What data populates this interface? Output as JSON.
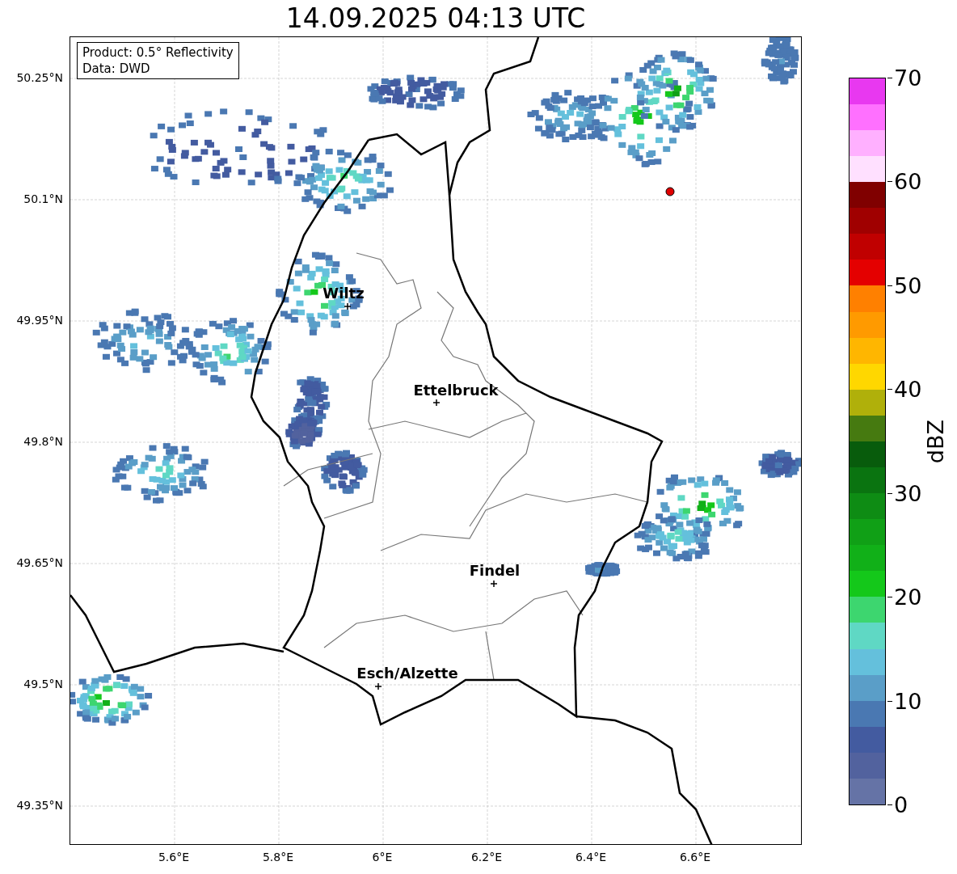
{
  "title": "14.09.2025 04:13 UTC",
  "info_box": {
    "lines": [
      "Product: 0.5° Reflectivity",
      "Data: DWD"
    ]
  },
  "y_ticks": [
    "50.25°N",
    "50.1°N",
    "49.95°N",
    "49.8°N",
    "49.65°N",
    "49.5°N",
    "49.35°N"
  ],
  "x_ticks": [
    "5.6°E",
    "5.8°E",
    "6°E",
    "6.2°E",
    "6.4°E",
    "6.6°E"
  ],
  "cities": [
    {
      "name": "Wiltz"
    },
    {
      "name": "Ettelbruck"
    },
    {
      "name": "Findel"
    },
    {
      "name": "Esch/Alzette"
    }
  ],
  "colorbar": {
    "label": "dBZ",
    "ticks": [
      "70",
      "60",
      "50",
      "40",
      "30",
      "20",
      "10",
      "0"
    ],
    "bins": [
      {
        "color": "#6573a6"
      },
      {
        "color": "#52629e"
      },
      {
        "color": "#435ba0"
      },
      {
        "color": "#4a78b2"
      },
      {
        "color": "#5a9ec8"
      },
      {
        "color": "#64c0dc"
      },
      {
        "color": "#5fd8c4"
      },
      {
        "color": "#3dd66f"
      },
      {
        "color": "#14c81a"
      },
      {
        "color": "#11b018"
      },
      {
        "color": "#10a016"
      },
      {
        "color": "#0e8c14"
      },
      {
        "color": "#0a7410"
      },
      {
        "color": "#085c0c"
      },
      {
        "color": "#467a10"
      },
      {
        "color": "#b0b00a"
      },
      {
        "color": "#ffd700"
      },
      {
        "color": "#ffb600"
      },
      {
        "color": "#ff9a00"
      },
      {
        "color": "#ff8000"
      },
      {
        "color": "#e40000"
      },
      {
        "color": "#c00000"
      },
      {
        "color": "#a00000"
      },
      {
        "color": "#800000"
      },
      {
        "color": "#ffe0ff"
      },
      {
        "color": "#ffb0ff"
      },
      {
        "color": "#ff70ff"
      },
      {
        "color": "#e838f0"
      }
    ]
  }
}
